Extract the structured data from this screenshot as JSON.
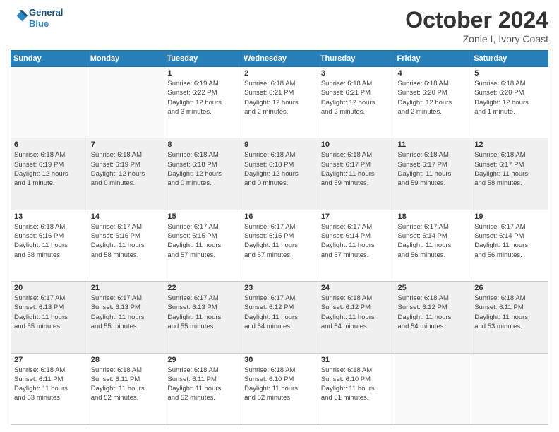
{
  "header": {
    "logo_line1": "General",
    "logo_line2": "Blue",
    "month": "October 2024",
    "location": "Zonle I, Ivory Coast"
  },
  "weekdays": [
    "Sunday",
    "Monday",
    "Tuesday",
    "Wednesday",
    "Thursday",
    "Friday",
    "Saturday"
  ],
  "rows": [
    [
      {
        "day": "",
        "info": ""
      },
      {
        "day": "",
        "info": ""
      },
      {
        "day": "1",
        "info": "Sunrise: 6:19 AM\nSunset: 6:22 PM\nDaylight: 12 hours\nand 3 minutes."
      },
      {
        "day": "2",
        "info": "Sunrise: 6:18 AM\nSunset: 6:21 PM\nDaylight: 12 hours\nand 2 minutes."
      },
      {
        "day": "3",
        "info": "Sunrise: 6:18 AM\nSunset: 6:21 PM\nDaylight: 12 hours\nand 2 minutes."
      },
      {
        "day": "4",
        "info": "Sunrise: 6:18 AM\nSunset: 6:20 PM\nDaylight: 12 hours\nand 2 minutes."
      },
      {
        "day": "5",
        "info": "Sunrise: 6:18 AM\nSunset: 6:20 PM\nDaylight: 12 hours\nand 1 minute."
      }
    ],
    [
      {
        "day": "6",
        "info": "Sunrise: 6:18 AM\nSunset: 6:19 PM\nDaylight: 12 hours\nand 1 minute."
      },
      {
        "day": "7",
        "info": "Sunrise: 6:18 AM\nSunset: 6:19 PM\nDaylight: 12 hours\nand 0 minutes."
      },
      {
        "day": "8",
        "info": "Sunrise: 6:18 AM\nSunset: 6:18 PM\nDaylight: 12 hours\nand 0 minutes."
      },
      {
        "day": "9",
        "info": "Sunrise: 6:18 AM\nSunset: 6:18 PM\nDaylight: 12 hours\nand 0 minutes."
      },
      {
        "day": "10",
        "info": "Sunrise: 6:18 AM\nSunset: 6:17 PM\nDaylight: 11 hours\nand 59 minutes."
      },
      {
        "day": "11",
        "info": "Sunrise: 6:18 AM\nSunset: 6:17 PM\nDaylight: 11 hours\nand 59 minutes."
      },
      {
        "day": "12",
        "info": "Sunrise: 6:18 AM\nSunset: 6:17 PM\nDaylight: 11 hours\nand 58 minutes."
      }
    ],
    [
      {
        "day": "13",
        "info": "Sunrise: 6:18 AM\nSunset: 6:16 PM\nDaylight: 11 hours\nand 58 minutes."
      },
      {
        "day": "14",
        "info": "Sunrise: 6:17 AM\nSunset: 6:16 PM\nDaylight: 11 hours\nand 58 minutes."
      },
      {
        "day": "15",
        "info": "Sunrise: 6:17 AM\nSunset: 6:15 PM\nDaylight: 11 hours\nand 57 minutes."
      },
      {
        "day": "16",
        "info": "Sunrise: 6:17 AM\nSunset: 6:15 PM\nDaylight: 11 hours\nand 57 minutes."
      },
      {
        "day": "17",
        "info": "Sunrise: 6:17 AM\nSunset: 6:14 PM\nDaylight: 11 hours\nand 57 minutes."
      },
      {
        "day": "18",
        "info": "Sunrise: 6:17 AM\nSunset: 6:14 PM\nDaylight: 11 hours\nand 56 minutes."
      },
      {
        "day": "19",
        "info": "Sunrise: 6:17 AM\nSunset: 6:14 PM\nDaylight: 11 hours\nand 56 minutes."
      }
    ],
    [
      {
        "day": "20",
        "info": "Sunrise: 6:17 AM\nSunset: 6:13 PM\nDaylight: 11 hours\nand 55 minutes."
      },
      {
        "day": "21",
        "info": "Sunrise: 6:17 AM\nSunset: 6:13 PM\nDaylight: 11 hours\nand 55 minutes."
      },
      {
        "day": "22",
        "info": "Sunrise: 6:17 AM\nSunset: 6:13 PM\nDaylight: 11 hours\nand 55 minutes."
      },
      {
        "day": "23",
        "info": "Sunrise: 6:17 AM\nSunset: 6:12 PM\nDaylight: 11 hours\nand 54 minutes."
      },
      {
        "day": "24",
        "info": "Sunrise: 6:18 AM\nSunset: 6:12 PM\nDaylight: 11 hours\nand 54 minutes."
      },
      {
        "day": "25",
        "info": "Sunrise: 6:18 AM\nSunset: 6:12 PM\nDaylight: 11 hours\nand 54 minutes."
      },
      {
        "day": "26",
        "info": "Sunrise: 6:18 AM\nSunset: 6:11 PM\nDaylight: 11 hours\nand 53 minutes."
      }
    ],
    [
      {
        "day": "27",
        "info": "Sunrise: 6:18 AM\nSunset: 6:11 PM\nDaylight: 11 hours\nand 53 minutes."
      },
      {
        "day": "28",
        "info": "Sunrise: 6:18 AM\nSunset: 6:11 PM\nDaylight: 11 hours\nand 52 minutes."
      },
      {
        "day": "29",
        "info": "Sunrise: 6:18 AM\nSunset: 6:11 PM\nDaylight: 11 hours\nand 52 minutes."
      },
      {
        "day": "30",
        "info": "Sunrise: 6:18 AM\nSunset: 6:10 PM\nDaylight: 11 hours\nand 52 minutes."
      },
      {
        "day": "31",
        "info": "Sunrise: 6:18 AM\nSunset: 6:10 PM\nDaylight: 11 hours\nand 51 minutes."
      },
      {
        "day": "",
        "info": ""
      },
      {
        "day": "",
        "info": ""
      }
    ]
  ]
}
